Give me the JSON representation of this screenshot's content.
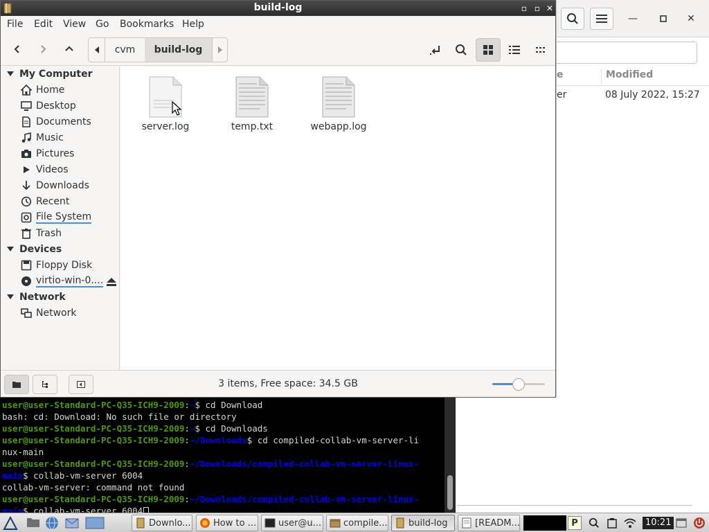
{
  "window": {
    "title": "build-log"
  },
  "menu": [
    "File",
    "Edit",
    "View",
    "Go",
    "Bookmarks",
    "Help"
  ],
  "path": {
    "segments": [
      "cvm",
      "build-log"
    ]
  },
  "sidebar": {
    "my_computer": "My Computer",
    "places": [
      {
        "label": "Home",
        "icon": "home-icon"
      },
      {
        "label": "Desktop",
        "icon": "desktop-icon"
      },
      {
        "label": "Documents",
        "icon": "documents-icon"
      },
      {
        "label": "Music",
        "icon": "music-icon"
      },
      {
        "label": "Pictures",
        "icon": "pictures-icon"
      },
      {
        "label": "Videos",
        "icon": "videos-icon"
      },
      {
        "label": "Downloads",
        "icon": "downloads-icon"
      },
      {
        "label": "Recent",
        "icon": "recent-icon"
      },
      {
        "label": "File System",
        "icon": "filesystem-icon"
      },
      {
        "label": "Trash",
        "icon": "trash-icon"
      }
    ],
    "devices": "Devices",
    "device_items": [
      {
        "label": "Floppy Disk",
        "icon": "floppy-icon"
      },
      {
        "label": "virtio-win-0....",
        "icon": "disc-icon"
      }
    ],
    "network": "Network",
    "network_items": [
      {
        "label": "Network",
        "icon": "network-icon"
      }
    ]
  },
  "files": [
    {
      "name": "server.log"
    },
    {
      "name": "temp.txt"
    },
    {
      "name": "webapp.log"
    }
  ],
  "status": {
    "text": "3 items, Free space: 34.5 GB",
    "zoom": 0.5
  },
  "background_window": {
    "col_partial": "e",
    "col_modified": "Modified",
    "row_partial": "er",
    "row_modified": "08 July 2022, 15:27"
  },
  "terminal": {
    "lines": [
      {
        "prompt": "user@user-Standard-PC-Q35-ICH9-2009",
        "path": "~",
        "cmd": "$ cd Download"
      },
      {
        "text": "bash: cd: Download: No such file or directory"
      },
      {
        "prompt": "user@user-Standard-PC-Q35-ICH9-2009",
        "path": "~",
        "cmd": "$ cd Downloads"
      },
      {
        "prompt": "user@user-Standard-PC-Q35-ICH9-2009",
        "path": "~/Downloads",
        "cmd": "$ cd compiled-collab-vm-server-li"
      },
      {
        "text": "nux-main"
      },
      {
        "prompt": "user@user-Standard-PC-Q35-ICH9-2009",
        "path": "~/Downloads/compiled-collab-vm-server-linux-",
        "cmd": ""
      },
      {
        "path": "main",
        "cmd": "$ collab-vm-server 6004"
      },
      {
        "text": "collab-vm-server: command not found"
      },
      {
        "prompt": "user@user-Standard-PC-Q35-ICH9-2009",
        "path": "~/Downloads/compiled-collab-vm-server-linux-",
        "cmd": ""
      },
      {
        "path": "main",
        "cmd": "$ collab-vm-server 6004"
      }
    ]
  },
  "taskbar": {
    "tasks": [
      {
        "label": "Downlo...",
        "icon": "folder-icon"
      },
      {
        "label": "How to ...",
        "icon": "firefox-icon"
      },
      {
        "label": "user@u...",
        "icon": "terminal-icon"
      },
      {
        "label": "compile...",
        "icon": "archive-icon"
      },
      {
        "label": "build-log",
        "icon": "folder-icon"
      },
      {
        "label": "[READM...",
        "icon": "text-editor-icon"
      }
    ],
    "clock": "10:21"
  },
  "colors": {
    "accent": "#4a90d9",
    "terminal_green": "#4e9a06",
    "terminal_blue": "#0000ee"
  }
}
